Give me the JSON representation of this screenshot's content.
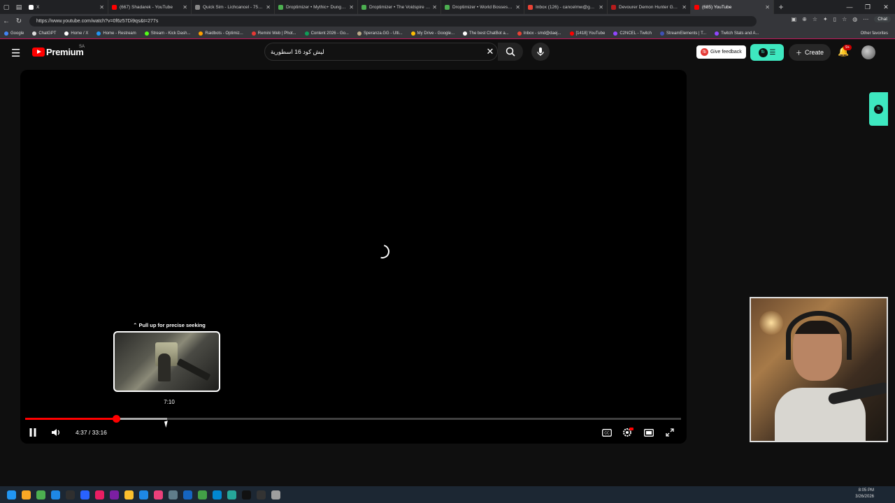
{
  "browser": {
    "tabs": [
      {
        "title": "X",
        "color": "#ffffff",
        "active": false
      },
      {
        "title": "(667) Shadarek - YouTube",
        "color": "#ff0000",
        "active": false
      },
      {
        "title": "Quick Sim - Lichcancel - 75,177 DPS",
        "color": "#888888",
        "active": false
      },
      {
        "title": "Droptimizer • Mythic+ Dungeons",
        "color": "#4caf50",
        "active": false
      },
      {
        "title": "Droptimizer • The Voidspire • Heroic",
        "color": "#4caf50",
        "active": false
      },
      {
        "title": "Droptimizer • World Bosses - Lich",
        "color": "#4caf50",
        "active": false
      },
      {
        "title": "Inbox (126) - cancelmw@gmail.com",
        "color": "#ea4335",
        "active": false
      },
      {
        "title": "Devourer Demon Hunter Gear and",
        "color": "#b71c1c",
        "active": false
      },
      {
        "title": "(685) YouTube",
        "color": "#ff0000",
        "active": true
      }
    ],
    "url": "https://www.youtube.com/watch?v=0f6z57Di9qs&t=277s",
    "chat_label": "Chat",
    "bookmarks": [
      {
        "label": "Google",
        "color": "#4285f4"
      },
      {
        "label": "ChatGPT",
        "color": "#dddddd"
      },
      {
        "label": "Home / X",
        "color": "#ffffff"
      },
      {
        "label": "Home - Restream",
        "color": "#2196f3"
      },
      {
        "label": "Stream - Kick Dash...",
        "color": "#53fc18"
      },
      {
        "label": "Raidbots - Optimiz...",
        "color": "#ffa000"
      },
      {
        "label": "Remini Web | Phot...",
        "color": "#e53935"
      },
      {
        "label": "Content 2026 - Go...",
        "color": "#0f9d58"
      },
      {
        "label": "Speranza.GG - Ulti...",
        "color": "#bbaa88"
      },
      {
        "label": "My Drive - Google...",
        "color": "#fbbc04"
      },
      {
        "label": "The best ChatBot a...",
        "color": "#ffffff"
      },
      {
        "label": "Inbox - smd@daej...",
        "color": "#ea4335"
      },
      {
        "label": "[1418] YouTube",
        "color": "#ff0000"
      },
      {
        "label": "C2NCEL - Twitch",
        "color": "#9146ff"
      },
      {
        "label": "StreamElements | T...",
        "color": "#3f51b5"
      },
      {
        "label": "Twitch Stats and A...",
        "color": "#9146ff"
      }
    ],
    "other_favorites": "Other favorites"
  },
  "youtube": {
    "logo_text": "Premium",
    "region": "SA",
    "search_query": "ليش كود 16 اسطورية",
    "feedback_label": "Give feedback",
    "create_label": "Create",
    "notification_count": "9+",
    "ext_label": "fb"
  },
  "player": {
    "seek_hint": "⌃ Pull up for precise seeking",
    "preview_time": "7:10",
    "current_time": "4:37",
    "duration": "33:16",
    "time_display": "4:37 / 33:16",
    "played_fraction": 0.139,
    "buffered_fraction": 0.216
  },
  "taskbar": {
    "time": "8:05 PM",
    "date": "3/26/2026",
    "icons": [
      "#2196f3",
      "#f9a825",
      "#4caf50",
      "#1e88e5",
      "#2f2f2f",
      "#2962ff",
      "#e91e63",
      "#7b1fa2",
      "#fbc02d",
      "#1e88e5",
      "#ec407a",
      "#607d8b",
      "#1565c0",
      "#43a047",
      "#0288d1",
      "#26a69a",
      "#111111",
      "#333333",
      "#9e9e9e"
    ]
  }
}
